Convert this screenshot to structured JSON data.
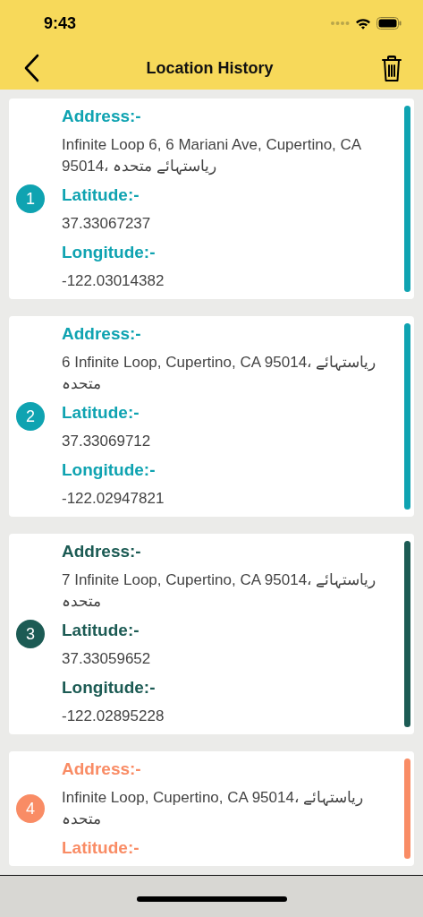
{
  "status_bar": {
    "time": "9:43"
  },
  "nav": {
    "title": "Location History"
  },
  "locations": [
    {
      "number": "1",
      "color": "#0fa3b1",
      "address_label": "Address:-",
      "address": "Infinite Loop 6, 6 Mariani Ave, Cupertino, CA 95014، ریاستہائے متحدہ",
      "latitude_label": "Latitude:-",
      "latitude": "37.33067237",
      "longitude_label": "Longitude:-",
      "longitude": "-122.03014382"
    },
    {
      "number": "2",
      "color": "#0fa3b1",
      "address_label": "Address:-",
      "address": "6 Infinite Loop, Cupertino, CA 95014، ریاستہائے متحدہ",
      "latitude_label": "Latitude:-",
      "latitude": "37.33069712",
      "longitude_label": "Longitude:-",
      "longitude": "-122.02947821"
    },
    {
      "number": "3",
      "color": "#1c5b54",
      "address_label": "Address:-",
      "address": "7 Infinite Loop, Cupertino, CA 95014، ریاستہائے متحدہ",
      "latitude_label": "Latitude:-",
      "latitude": "37.33059652",
      "longitude_label": "Longitude:-",
      "longitude": "-122.02895228"
    },
    {
      "number": "4",
      "color": "#f98c65",
      "address_label": "Address:-",
      "address": "Infinite Loop, Cupertino, CA 95014، ریاستہائے متحدہ",
      "latitude_label": "Latitude:-"
    }
  ]
}
